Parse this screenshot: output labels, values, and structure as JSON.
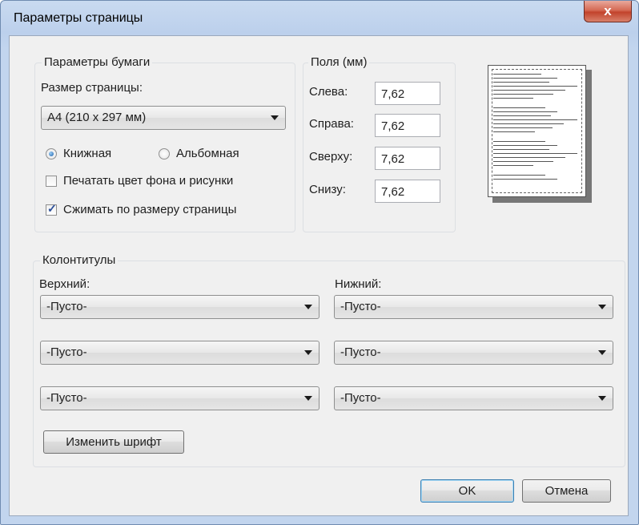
{
  "window": {
    "title": "Параметры страницы",
    "close_label": "x"
  },
  "paper": {
    "legend": "Параметры бумаги",
    "size_label": "Размер страницы:",
    "size_value": "A4 (210 x 297 мм)",
    "orientation": {
      "portrait": "Книжная",
      "landscape": "Альбомная",
      "selected": "portrait"
    },
    "print_background": {
      "label": "Печатать цвет фона и рисунки",
      "checked": false
    },
    "shrink_to_fit": {
      "label": "Сжимать по размеру страницы",
      "checked": true
    }
  },
  "margins": {
    "legend": "Поля (мм)",
    "left_label": "Слева:",
    "left_value": "7,62",
    "right_label": "Справа:",
    "right_value": "7,62",
    "top_label": "Сверху:",
    "top_value": "7,62",
    "bottom_label": "Снизу:",
    "bottom_value": "7,62"
  },
  "headers_footers": {
    "legend": "Колонтитулы",
    "header_label": "Верхний:",
    "footer_label": "Нижний:",
    "header_values": [
      "-Пусто-",
      "-Пусто-",
      "-Пусто-"
    ],
    "footer_values": [
      "-Пусто-",
      "-Пусто-",
      "-Пусто-"
    ],
    "font_button": "Изменить шрифт"
  },
  "buttons": {
    "ok": "OK",
    "cancel": "Отмена"
  },
  "colors": {
    "accent": "#3c7fb1",
    "close": "#c7503a",
    "title_bar": "#c2d5ee"
  }
}
